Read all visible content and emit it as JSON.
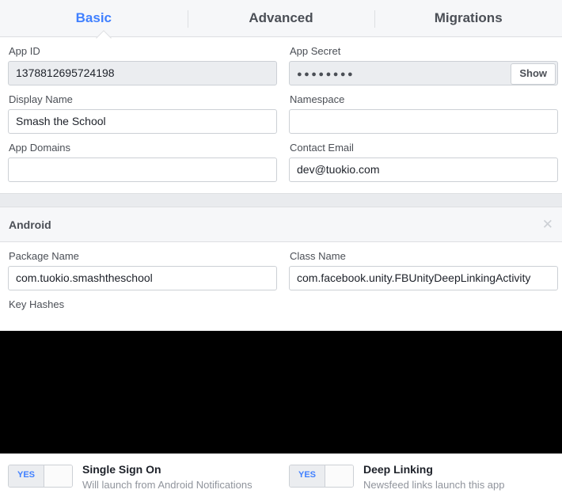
{
  "tabs": [
    {
      "label": "Basic",
      "active": true
    },
    {
      "label": "Advanced",
      "active": false
    },
    {
      "label": "Migrations",
      "active": false
    }
  ],
  "basic": {
    "app_id": {
      "label": "App ID",
      "value": "1378812695724198"
    },
    "app_secret": {
      "label": "App Secret",
      "value": "●●●●●●●●",
      "show_button": "Show"
    },
    "display_name": {
      "label": "Display Name",
      "value": "Smash the School",
      "placeholder": ""
    },
    "namespace": {
      "label": "Namespace",
      "value": "",
      "placeholder": ""
    },
    "app_domains": {
      "label": "App Domains",
      "value": "",
      "placeholder": ""
    },
    "contact_email": {
      "label": "Contact Email",
      "value": "dev@tuokio.com",
      "placeholder": ""
    }
  },
  "android": {
    "section_title": "Android",
    "close_icon": "✕",
    "package_name": {
      "label": "Package Name",
      "value": "com.tuokio.smashtheschool",
      "placeholder": ""
    },
    "class_name": {
      "label": "Class Name",
      "value": "com.facebook.unity.FBUnityDeepLinkingActivity",
      "placeholder": ""
    },
    "key_hashes": {
      "label": "Key Hashes"
    },
    "toggles": [
      {
        "state_label": "YES",
        "title": "Single Sign On",
        "subtitle": "Will launch from Android Notifications"
      },
      {
        "state_label": "YES",
        "title": "Deep Linking",
        "subtitle": "Newsfeed links launch this app"
      }
    ]
  },
  "colors": {
    "accent": "#4080ff",
    "text": "#1d2129",
    "muted": "#90949c",
    "label": "#4b4f56",
    "border": "#ccd0d5",
    "band": "#e9ebee",
    "disabled_field": "#ebedf0",
    "redacted": "#000000"
  }
}
